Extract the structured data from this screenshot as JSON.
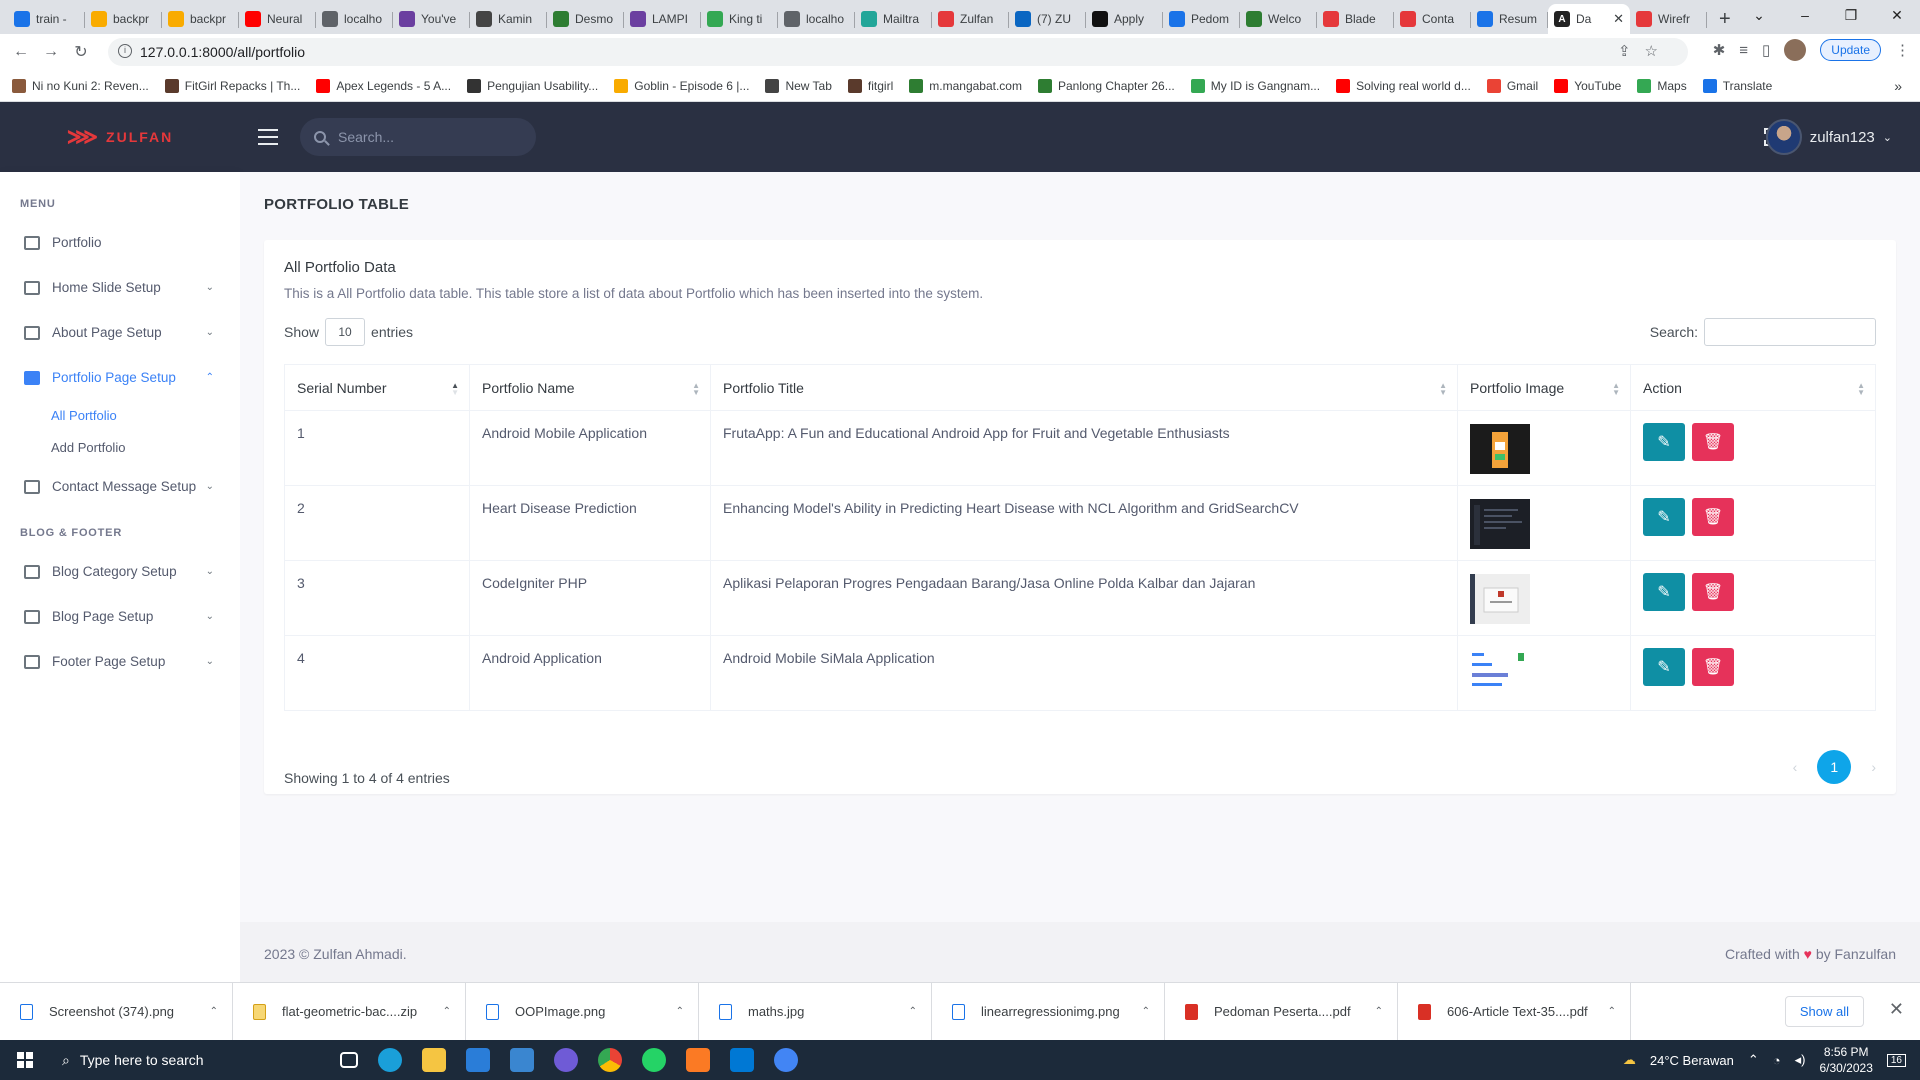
{
  "browser": {
    "tabs": [
      {
        "label": "train -",
        "color": "#1a73e8"
      },
      {
        "label": "backpr",
        "color": "#f9ab00"
      },
      {
        "label": "backpr",
        "color": "#f9ab00"
      },
      {
        "label": "Neural",
        "color": "#ff0000"
      },
      {
        "label": "localho",
        "color": "#5f6368"
      },
      {
        "label": "You've",
        "color": "#6b3fa0"
      },
      {
        "label": "Kamin",
        "color": "#444444"
      },
      {
        "label": "Desmo",
        "color": "#2e7d32"
      },
      {
        "label": "LAMPI",
        "color": "#6b3fa0"
      },
      {
        "label": "King ti",
        "color": "#34a853"
      },
      {
        "label": "localho",
        "color": "#5f6368"
      },
      {
        "label": "Mailtra",
        "color": "#22a699"
      },
      {
        "label": "Zulfan",
        "color": "#e5383b"
      },
      {
        "label": "(7) ZU",
        "color": "#0a66c2"
      },
      {
        "label": "Apply",
        "color": "#111111"
      },
      {
        "label": "Pedom",
        "color": "#1a73e8"
      },
      {
        "label": "Welco",
        "color": "#2e7d32"
      },
      {
        "label": "Blade",
        "color": "#e5383b"
      },
      {
        "label": "Conta",
        "color": "#e5383b"
      },
      {
        "label": "Resum",
        "color": "#1a73e8"
      }
    ],
    "active_tab": {
      "label": "Da",
      "color": "#222222"
    },
    "extra_tab": {
      "label": "Wirefr",
      "color": "#e5383b"
    },
    "new_tab": "+",
    "window_controls": [
      "⌄",
      "–",
      "❐",
      "✕"
    ],
    "url": "127.0.0.1:8000/all/portfolio",
    "update_label": "Update",
    "bookmarks": [
      {
        "label": "Ni no Kuni 2: Reven...",
        "color": "#8a5a3c"
      },
      {
        "label": "FitGirl Repacks | Th...",
        "color": "#5a3a2c"
      },
      {
        "label": "Apex Legends - 5 A...",
        "color": "#ff0000"
      },
      {
        "label": "Pengujian Usability...",
        "color": "#333333"
      },
      {
        "label": "Goblin - Episode 6 |...",
        "color": "#f9ab00"
      },
      {
        "label": "New Tab",
        "color": "#444444"
      },
      {
        "label": "fitgirl",
        "color": "#5a3a2c"
      },
      {
        "label": "m.mangabat.com",
        "color": "#2e7d32"
      },
      {
        "label": "Panlong Chapter 26...",
        "color": "#2e7d32"
      },
      {
        "label": "My ID is Gangnam...",
        "color": "#34a853"
      },
      {
        "label": "Solving real world d...",
        "color": "#ff0000"
      },
      {
        "label": "Gmail",
        "color": "#ea4335"
      },
      {
        "label": "YouTube",
        "color": "#ff0000"
      },
      {
        "label": "Maps",
        "color": "#34a853"
      },
      {
        "label": "Translate",
        "color": "#1a73e8"
      }
    ]
  },
  "app": {
    "brand": "ZULFAN",
    "search_placeholder": "Search...",
    "username": "zulfan123",
    "sidebar": {
      "menu_title": "MENU",
      "items": [
        {
          "label": "Portfolio",
          "chevron": ""
        },
        {
          "label": "Home Slide Setup",
          "chevron": "⌄"
        },
        {
          "label": "About Page Setup",
          "chevron": "⌄"
        },
        {
          "label": "Portfolio Page Setup",
          "chevron": "⌃"
        }
      ],
      "subitems": [
        {
          "label": "All Portfolio"
        },
        {
          "label": "Add Portfolio"
        }
      ],
      "contact_item": {
        "label": "Contact Message Setup",
        "chevron": "⌄"
      },
      "section2_title": "BLOG & FOOTER",
      "items2": [
        {
          "label": "Blog Category Setup",
          "chevron": "⌄"
        },
        {
          "label": "Blog Page Setup",
          "chevron": "⌄"
        },
        {
          "label": "Footer Page Setup",
          "chevron": "⌄"
        }
      ]
    },
    "page_title": "PORTFOLIO TABLE",
    "card": {
      "title": "All Portfolio Data",
      "description": "This is a All Portfolio data table. This table store a list of data about Portfolio which has been inserted into the system.",
      "show_label": "Show",
      "entries_value": "10",
      "entries_label": "entries",
      "search_label": "Search:"
    },
    "table": {
      "headers": [
        "Serial Number",
        "Portfolio Name",
        "Portfolio Title",
        "Portfolio Image",
        "Action"
      ],
      "rows": [
        {
          "serial": "1",
          "name": "Android Mobile Application",
          "title": "FrutaApp: A Fun and Educational Android App for Fruit and Vegetable Enthusiasts"
        },
        {
          "serial": "2",
          "name": "Heart Disease Prediction",
          "title": "Enhancing Model's Ability in Predicting Heart Disease with NCL Algorithm and GridSearchCV"
        },
        {
          "serial": "3",
          "name": "CodeIgniter PHP",
          "title": "Aplikasi Pelaporan Progres Pengadaan Barang/Jasa Online Polda Kalbar dan Jajaran"
        },
        {
          "serial": "4",
          "name": "Android Application",
          "title": "Android Mobile SiMala Application"
        }
      ]
    },
    "info": "Showing 1 to 4 of 4 entries",
    "pagination": {
      "prev": "‹",
      "current": "1",
      "next": "›"
    },
    "footer": {
      "left": "2023 © Zulfan Ahmadi.",
      "right_prefix": "Crafted with",
      "heart": "♥",
      "right_suffix": "by Fanzulfan"
    }
  },
  "downloads": {
    "items": [
      {
        "label": "Screenshot (374).png",
        "type": "png"
      },
      {
        "label": "flat-geometric-bac....zip",
        "type": "zip"
      },
      {
        "label": "OOPImage.png",
        "type": "png"
      },
      {
        "label": "maths.jpg",
        "type": "png"
      },
      {
        "label": "linearregressionimg.png",
        "type": "png"
      },
      {
        "label": "Pedoman Peserta....pdf",
        "type": "pdf"
      },
      {
        "label": "606-Article Text-35....pdf",
        "type": "pdf"
      }
    ],
    "show_all": "Show all"
  },
  "taskbar": {
    "search_placeholder": "Type here to search",
    "weather": "24°C  Berawan",
    "time": "8:56 PM",
    "date": "6/30/2023",
    "notification_count": "16"
  }
}
